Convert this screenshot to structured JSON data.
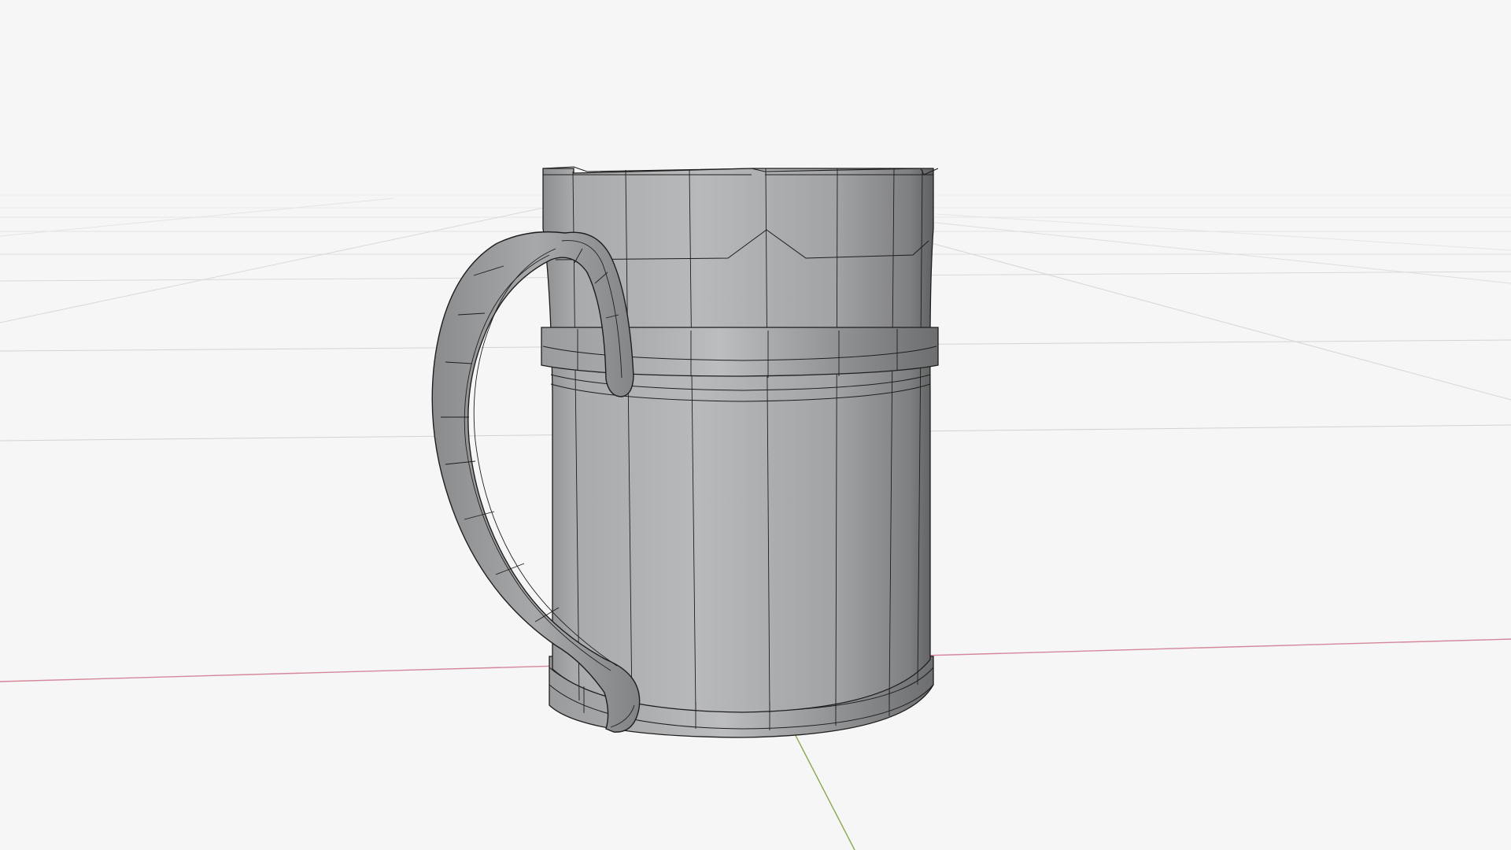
{
  "viewport": {
    "mode": "3d-wireframe-viewport",
    "object": "mug-model",
    "colors": {
      "background": "#f6f6f6",
      "grid": "#d6d6d6",
      "grid_faint": "#e6e6e6",
      "x_axis": "#d4869a",
      "y_axis": "#8aa84e",
      "mesh_light": "#b9babc",
      "mesh_mid": "#a4a5a7",
      "mesh_dark": "#6f7072",
      "wire": "#1e1e1e"
    }
  }
}
